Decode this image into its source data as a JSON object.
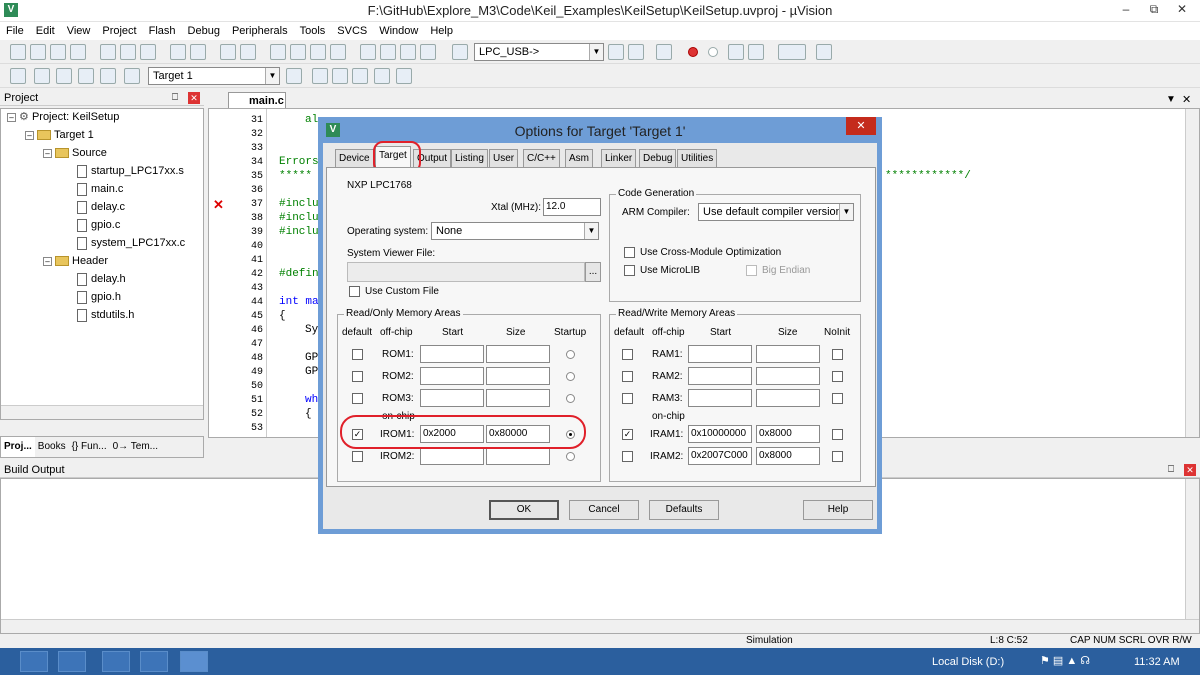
{
  "window": {
    "title": "F:\\GitHub\\Explore_M3\\Code\\Keil_Examples\\KeilSetup\\KeilSetup.uvproj - µVision",
    "icon_letter": "V"
  },
  "menu": [
    "File",
    "Edit",
    "View",
    "Project",
    "Flash",
    "Debug",
    "Peripherals",
    "Tools",
    "SVCS",
    "Window",
    "Help"
  ],
  "toolbar": {
    "device_combo": "LPC_USB->",
    "target_combo": "Target 1"
  },
  "project_panel": {
    "title": "Project",
    "tree": {
      "project": "Project: KeilSetup",
      "target": "Target 1",
      "source_group": "Source",
      "source_files": [
        "startup_LPC17xx.s",
        "main.c",
        "delay.c",
        "gpio.c",
        "system_LPC17xx.c"
      ],
      "header_group": "Header",
      "header_files": [
        "delay.h",
        "gpio.h",
        "stdutils.h"
      ]
    },
    "tabs": [
      "Proj...",
      "Books",
      "{} Fun...",
      "0→ Tem..."
    ]
  },
  "editor": {
    "tab": "main.c",
    "line_numbers": [
      "31",
      "32",
      "33",
      "34",
      "35",
      "36",
      "37",
      "38",
      "39",
      "40",
      "41",
      "42",
      "43",
      "44",
      "45",
      "46",
      "47",
      "48",
      "49",
      "50",
      "51",
      "52",
      "53"
    ],
    "lines": {
      "l31": "al",
      "l34": "Errors",
      "l35": "*****",
      "l35r": "************/",
      "l37": "#inclu",
      "l38": "#inclu",
      "l39": "#inclu",
      "l42": "#defin",
      "l44": "int ma",
      "l45": "{",
      "l46": "Sy",
      "l48": "GP",
      "l49": "GP",
      "l51": "wh",
      "l52": "{"
    },
    "error_marker": "✕"
  },
  "build_output": {
    "title": "Build Output"
  },
  "status_bar": {
    "mode": "Simulation",
    "position": "L:8 C:52",
    "indicators": "CAP  NUM  SCRL  OVR  R/W"
  },
  "taskbar": {
    "drive": "Local Disk (D:)",
    "time": "11:32 AM"
  },
  "dialog": {
    "title": "Options for Target 'Target 1'",
    "tabs": [
      "Device",
      "Target",
      "Output",
      "Listing",
      "User",
      "C/C++",
      "Asm",
      "Linker",
      "Debug",
      "Utilities"
    ],
    "device": "NXP LPC1768",
    "xtal_label": "Xtal (MHz):",
    "xtal_value": "12.0",
    "os_label": "Operating system:",
    "os_value": "None",
    "svf_label": "System Viewer File:",
    "svf_browse": "...",
    "use_custom_file": "Use Custom File",
    "code_gen": {
      "title": "Code Generation",
      "arm_compiler_label": "ARM Compiler:",
      "arm_compiler_value": "Use default compiler version",
      "cross_module": "Use Cross-Module Optimization",
      "microlib": "Use MicroLIB",
      "big_endian": "Big Endian"
    },
    "rom": {
      "title": "Read/Only Memory Areas",
      "headers": {
        "default": "default",
        "offchip": "off-chip",
        "start": "Start",
        "size": "Size",
        "startup": "Startup"
      },
      "onchip_label": "on-chip",
      "rows": [
        {
          "name": "ROM1:",
          "start": "",
          "size": ""
        },
        {
          "name": "ROM2:",
          "start": "",
          "size": ""
        },
        {
          "name": "ROM3:",
          "start": "",
          "size": ""
        },
        {
          "name": "IROM1:",
          "start": "0x2000",
          "size": "0x80000"
        },
        {
          "name": "IROM2:",
          "start": "",
          "size": ""
        }
      ]
    },
    "ram": {
      "title": "Read/Write Memory Areas",
      "headers": {
        "default": "default",
        "offchip": "off-chip",
        "start": "Start",
        "size": "Size",
        "noinit": "NoInit"
      },
      "onchip_label": "on-chip",
      "rows": [
        {
          "name": "RAM1:",
          "start": "",
          "size": ""
        },
        {
          "name": "RAM2:",
          "start": "",
          "size": ""
        },
        {
          "name": "RAM3:",
          "start": "",
          "size": ""
        },
        {
          "name": "IRAM1:",
          "start": "0x10000000",
          "size": "0x8000"
        },
        {
          "name": "IRAM2:",
          "start": "0x2007C000",
          "size": "0x8000"
        }
      ]
    },
    "buttons": {
      "ok": "OK",
      "cancel": "Cancel",
      "defaults": "Defaults",
      "help": "Help"
    },
    "check_mark": "✓",
    "highlight_color": "#e0202a"
  }
}
